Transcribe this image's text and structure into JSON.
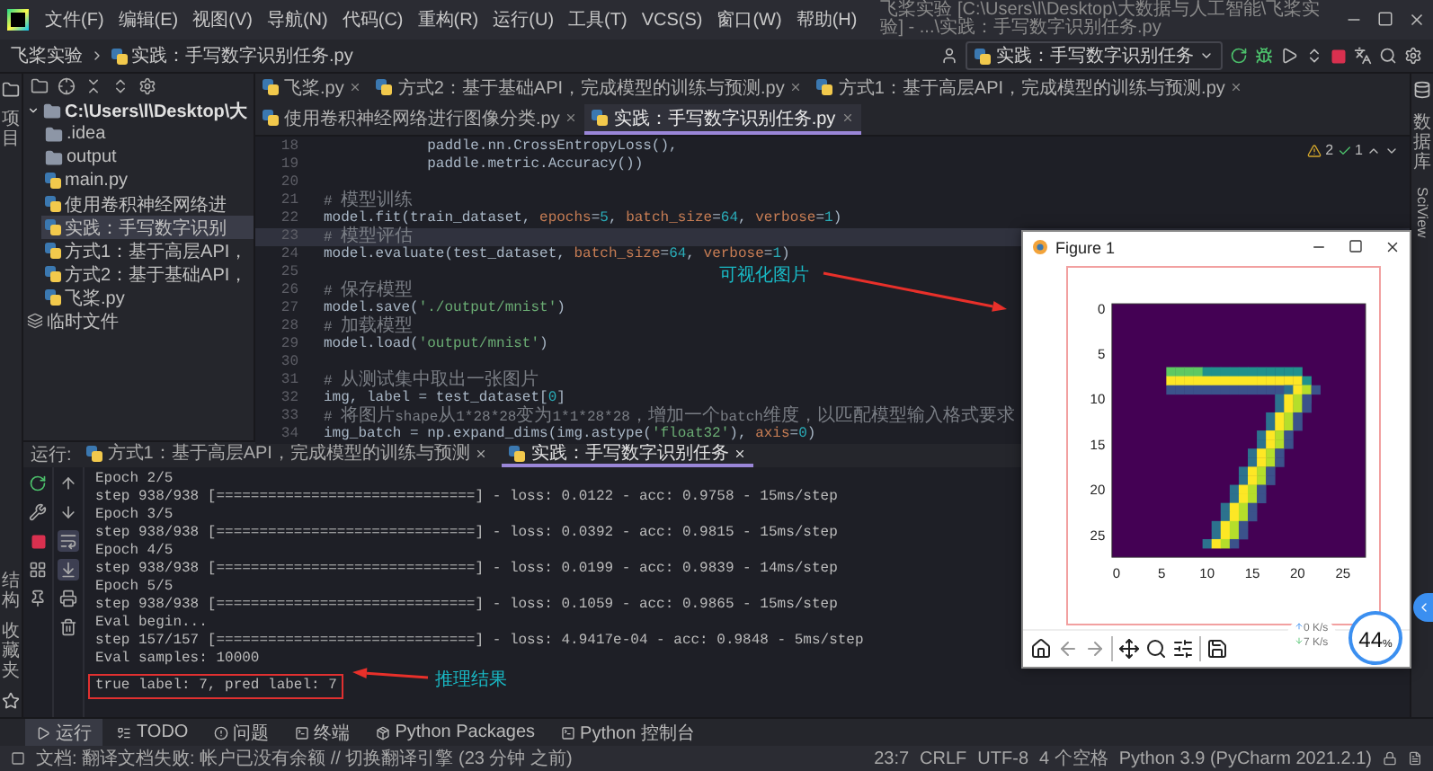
{
  "menu_bar": {
    "items": [
      "文件(F)",
      "编辑(E)",
      "视图(V)",
      "导航(N)",
      "代码(C)",
      "重构(R)",
      "运行(U)",
      "工具(T)",
      "VCS(S)",
      "窗口(W)",
      "帮助(H)"
    ],
    "window_title": "飞桨实验 [C:\\Users\\l\\Desktop\\大数据与人工智能\\飞桨实验] - ...\\实践：手写数字识别任务.py"
  },
  "nav_bar": {
    "breadcrumb": [
      "飞桨实验",
      "实践：手写数字识别任务.py"
    ],
    "run_config": "实践：手写数字识别任务"
  },
  "left_strip": {
    "top": "项目",
    "bottom": [
      "结构",
      "收藏夹"
    ]
  },
  "project_panel": {
    "tree": [
      {
        "label": "C:\\Users\\l\\Desktop\\大",
        "kind": "folder",
        "selected": false,
        "expanded": true,
        "children": [
          {
            "label": ".idea",
            "kind": "folder",
            "selected": false
          },
          {
            "label": "output",
            "kind": "folder",
            "selected": false
          },
          {
            "label": "main.py",
            "kind": "file",
            "selected": false
          },
          {
            "label": "使用卷积神经网络进",
            "kind": "file",
            "selected": false
          },
          {
            "label": "实践：手写数字识别",
            "kind": "file",
            "selected": true
          },
          {
            "label": "方式1：基于高层API，",
            "kind": "file",
            "selected": false
          },
          {
            "label": "方式2：基于基础API，",
            "kind": "file",
            "selected": false
          },
          {
            "label": "飞桨.py",
            "kind": "file",
            "selected": false
          }
        ]
      },
      {
        "label": "临时文件",
        "kind": "scratch",
        "selected": false
      }
    ]
  },
  "editor_tabs": [
    {
      "label": "飞桨.py",
      "selected": false
    },
    {
      "label": "方式2：基于基础API，完成模型的训练与预测.py",
      "selected": false
    },
    {
      "label": "方式1：基于高层API，完成模型的训练与预测.py",
      "selected": false
    },
    {
      "label": "使用卷积神经网络进行图像分类.py",
      "selected": false
    },
    {
      "label": "实践：手写数字识别任务.py",
      "selected": true
    }
  ],
  "editor": {
    "inspections": {
      "warnings": "2",
      "passed": "1"
    },
    "lines": [
      {
        "number": "18",
        "current": false,
        "tokens": [
          {
            "text": "            paddle.nn.CrossEntropyLoss(),",
            "kind": "plain"
          }
        ]
      },
      {
        "number": "19",
        "current": false,
        "tokens": [
          {
            "text": "            paddle.metric.Accuracy())",
            "kind": "plain"
          }
        ]
      },
      {
        "number": "20",
        "current": false
      },
      {
        "number": "21",
        "current": false,
        "tokens": [
          {
            "text": "# 模型训练",
            "kind": "comment"
          }
        ]
      },
      {
        "number": "22",
        "current": false,
        "tokens": [
          {
            "text": "model.fit(train_dataset, ",
            "kind": "plain"
          },
          {
            "text": "epochs",
            "kind": "param"
          },
          {
            "text": "=",
            "kind": "plain"
          },
          {
            "text": "5",
            "kind": "number"
          },
          {
            "text": ", ",
            "kind": "plain"
          },
          {
            "text": "batch_size",
            "kind": "param"
          },
          {
            "text": "=",
            "kind": "plain"
          },
          {
            "text": "64",
            "kind": "number"
          },
          {
            "text": ", ",
            "kind": "plain"
          },
          {
            "text": "verbose",
            "kind": "param"
          },
          {
            "text": "=",
            "kind": "plain"
          },
          {
            "text": "1",
            "kind": "number"
          },
          {
            "text": ")",
            "kind": "plain"
          }
        ]
      },
      {
        "number": "23",
        "current": true,
        "tokens": [
          {
            "text": "# 模型评估",
            "kind": "comment"
          }
        ]
      },
      {
        "number": "24",
        "current": false,
        "tokens": [
          {
            "text": "model.evaluate(test_dataset, ",
            "kind": "plain"
          },
          {
            "text": "batch_size",
            "kind": "param"
          },
          {
            "text": "=",
            "kind": "plain"
          },
          {
            "text": "64",
            "kind": "number"
          },
          {
            "text": ", ",
            "kind": "plain"
          },
          {
            "text": "verbose",
            "kind": "param"
          },
          {
            "text": "=",
            "kind": "plain"
          },
          {
            "text": "1",
            "kind": "number"
          },
          {
            "text": ")",
            "kind": "plain"
          }
        ]
      },
      {
        "number": "25",
        "current": false
      },
      {
        "number": "26",
        "current": false,
        "tokens": [
          {
            "text": "# 保存模型",
            "kind": "comment"
          }
        ]
      },
      {
        "number": "27",
        "current": false,
        "tokens": [
          {
            "text": "model.save(",
            "kind": "plain"
          },
          {
            "text": "'./output/mnist'",
            "kind": "string"
          },
          {
            "text": ")",
            "kind": "plain"
          }
        ]
      },
      {
        "number": "28",
        "current": false,
        "tokens": [
          {
            "text": "# 加载模型",
            "kind": "comment"
          }
        ]
      },
      {
        "number": "29",
        "current": false,
        "tokens": [
          {
            "text": "model.load(",
            "kind": "plain"
          },
          {
            "text": "'output/mnist'",
            "kind": "string"
          },
          {
            "text": ")",
            "kind": "plain"
          }
        ]
      },
      {
        "number": "30",
        "current": false
      },
      {
        "number": "31",
        "current": false,
        "tokens": [
          {
            "text": "# 从测试集中取出一张图片",
            "kind": "comment"
          }
        ]
      },
      {
        "number": "32",
        "current": false,
        "tokens": [
          {
            "text": "img, label = test_dataset[",
            "kind": "plain"
          },
          {
            "text": "0",
            "kind": "number"
          },
          {
            "text": "]",
            "kind": "plain"
          }
        ]
      },
      {
        "number": "33",
        "current": false,
        "tokens": [
          {
            "text": "# 将图片shape从1*28*28变为1*1*28*28，增加一个batch维度，以匹配模型输入格式要求",
            "kind": "comment"
          }
        ]
      },
      {
        "number": "34",
        "current": false,
        "tokens": [
          {
            "text": "img_batch = np.expand_dims(img.astype(",
            "kind": "plain"
          },
          {
            "text": "'float32'",
            "kind": "string"
          },
          {
            "text": "), ",
            "kind": "plain"
          },
          {
            "text": "axis",
            "kind": "param"
          },
          {
            "text": "=",
            "kind": "plain"
          },
          {
            "text": "0",
            "kind": "number"
          },
          {
            "text": ")",
            "kind": "plain"
          }
        ]
      }
    ]
  },
  "right_strip": [
    "数据库",
    "SciView"
  ],
  "run_panel": {
    "label": "运行:",
    "tabs": [
      {
        "label": "方式1：基于高层API，完成模型的训练与预测",
        "selected": false
      },
      {
        "label": "实践：手写数字识别任务",
        "selected": true
      }
    ],
    "toggles": {
      "soft_wrap": true,
      "scroll_to_end": true
    },
    "console": [
      {
        "text": "Epoch 2/5",
        "boxed": false
      },
      {
        "text": "step 938/938 [==============================] - loss: 0.0122 - acc: 0.9758 - 15ms/step",
        "boxed": false
      },
      {
        "text": "Epoch 3/5",
        "boxed": false
      },
      {
        "text": "step 938/938 [==============================] - loss: 0.0392 - acc: 0.9815 - 15ms/step",
        "boxed": false
      },
      {
        "text": "Epoch 4/5",
        "boxed": false
      },
      {
        "text": "step 938/938 [==============================] - loss: 0.0199 - acc: 0.9839 - 14ms/step",
        "boxed": false
      },
      {
        "text": "Epoch 5/5",
        "boxed": false
      },
      {
        "text": "step 938/938 [==============================] - loss: 0.1059 - acc: 0.9865 - 15ms/step",
        "boxed": false
      },
      {
        "text": "Eval begin...",
        "boxed": false
      },
      {
        "text": "step 157/157 [==============================] - loss: 4.9417e-04 - acc: 0.9848 - 5ms/step",
        "boxed": false
      },
      {
        "text": "Eval samples: 10000",
        "boxed": false
      },
      {
        "text": "true label: 7, pred label: 7",
        "boxed": true
      }
    ]
  },
  "tool_windows": [
    {
      "label": "运行",
      "selected": true
    },
    {
      "label": "TODO",
      "selected": false
    },
    {
      "label": "问题",
      "selected": false
    },
    {
      "label": "终端",
      "selected": false
    },
    {
      "label": "Python Packages",
      "selected": false
    },
    {
      "label": "Python 控制台",
      "selected": false
    }
  ],
  "status_bar": {
    "message": "文档: 翻译文档失败: 帐户已没有余额 // 切换翻译引擎 (23 分钟 之前)",
    "items": [
      "23:7",
      "CRLF",
      "UTF-8",
      "4 个空格",
      "Python 3.9 (PyCharm 2021.2.1)"
    ]
  },
  "figure_window": {
    "title": "Figure 1",
    "y_ticks": [
      "0",
      "5",
      "10",
      "15",
      "20",
      "25"
    ],
    "x_ticks": [
      "0",
      "5",
      "10",
      "15",
      "20",
      "25"
    ]
  },
  "annotations": [
    {
      "text": "可视化图片"
    },
    {
      "text": "推理结果"
    }
  ],
  "net_widget": {
    "percent": "44",
    "unit": "%",
    "upload": "0 K/s",
    "download": "7 K/s"
  }
}
